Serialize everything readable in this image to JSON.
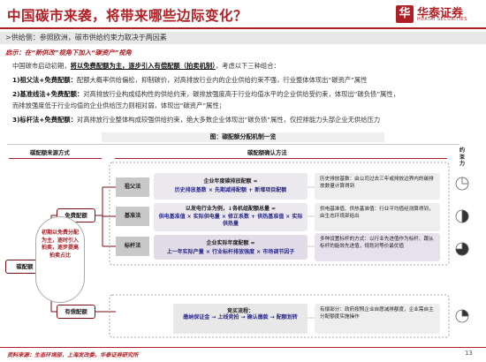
{
  "header": {
    "title": "中国碳市来袭，将带来哪些边际变化？",
    "logo_cn": "华泰证券",
    "logo_en": "HUATAI SECURITIES",
    "logo_mark": "华"
  },
  "subheader": ">供给侧：参照欧洲，碳市供给约束力取决于两因素",
  "insight": "启示：在“新供改”视角下加入“碳资产”视角",
  "paragraphs": {
    "p1_a": "中国碳市启动初期，",
    "p1_b": "将以免费配额为主，逐步引入有偿配额（拍卖机制）",
    "p1_c": "，考虑以下三种组合：",
    "p2_label": "1)祖父法+免费配额：",
    "p2_text": "配额大概率供给偏松，抑制碳价，对高排放行业内的企业供给约束不强，行业整体体现出“碳资产”属性",
    "p3_label": "2)基准线法+免费配额：",
    "p3_text": "对高排放行业构成结构性的供给约束，碳排放强度高于行业均值水平的企业供给受约束，体现出“碳负债”属性，",
    "p3_line2": "而排放强度低于行业均值的企业供给压力则相对弱，体现出“碳资产”属性；",
    "p4_label": "3)标杆法+免费配额：",
    "p4_text": "对高排放行业整体构成较强供给约束，绝大多数企业体现出“碳负债”属性，仅控排能力头部企业无供给压力"
  },
  "figure": {
    "title": "图：碳配额分配机制一览",
    "col_type": "碳配额来源方式",
    "col_method": "碳配额确认方法",
    "col_constraint": "约束力",
    "root": "碳配额",
    "free": "免费配额",
    "paid": "有偿配额",
    "center_text": "初期以免费分配为主，逐时引入拍卖，逐步提高拍卖占比",
    "rows": [
      {
        "method": "祖父法",
        "formula_title": "企业年度碳排放配额 =",
        "formula_body": "历史排放基数 × 先期减排配额 + 新增项目配额",
        "note": "历史排放基数：由公司过去三年或排放边界内的碳排放数量计算得到",
        "constraint": "weak"
      },
      {
        "method": "基准法",
        "formula_title": "以发电行业为例，↓各机组配额总量 =",
        "formula_body": "供电基准值 × 实际供电量 × 修正系数 + 供热基准值 × 实际供热量",
        "note": "供电基准值、供热基准值：行业平均值经测算得到，由生态环境部给出",
        "constraint": "medium"
      },
      {
        "method": "标杆法",
        "formula_title": "企业实际年度配额 =",
        "formula_body": "上一年实际产量 × 行业标杆排放强度 × 市场调节因子",
        "note": "多种设置标杆的方式：以行业先进值作为标杆、跟从标杆的能效先进值，规划对等价最优值",
        "constraint": "strong"
      }
    ],
    "auction": {
      "title": "竞买流程：",
      "body": "缴纳保证金 → 上线竞拍 → 确认缴款 → 配额划转",
      "note": "有偿部分：政府按照企业自愿减排额度，企业需自主分配额度实施操作",
      "constraint": "varies"
    }
  },
  "source": "资料来源：生态环境部，上海发改委，华泰证券研究所",
  "page_number": "13",
  "colors": {
    "brand": "#b01f24",
    "dark_red": "#7a0f14",
    "formula_text": "#2a2a8a"
  }
}
